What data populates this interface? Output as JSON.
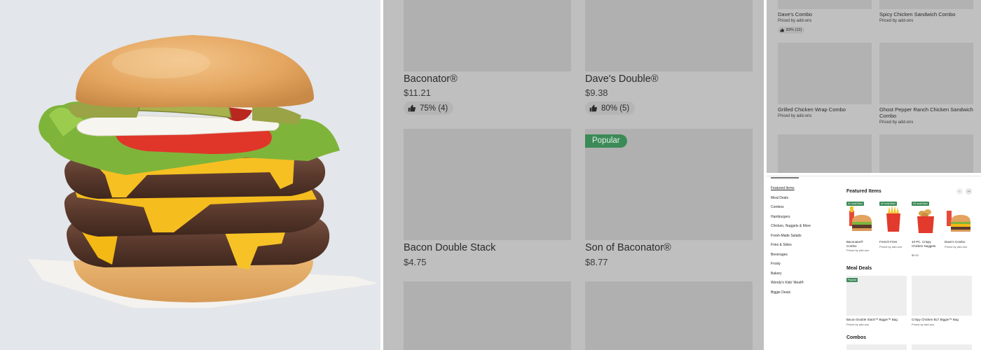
{
  "hero": {
    "image": "burger-photo",
    "background": "#e3e6ea"
  },
  "menu_grid": {
    "items": [
      {
        "name": "Baconator®",
        "price": "$11.21",
        "rating": "75% (4)"
      },
      {
        "name": "Dave's Double®",
        "price": "$9.38",
        "rating": "80% (5)"
      },
      {
        "name": "Bacon Double Stack",
        "price": "$4.75"
      },
      {
        "name": "Son of Baconator®",
        "price": "$8.77",
        "badge": "Popular"
      }
    ]
  },
  "combo_grid": {
    "items": [
      {
        "name": "Dave's Combo",
        "subtitle": "Priced by add-ons",
        "rating": "83% (12)"
      },
      {
        "name": "Spicy Chicken Sandwich Combo",
        "subtitle": "Priced by add-ons"
      },
      {
        "name": "Grilled Chicken Wrap Combo",
        "subtitle": "Priced by add-ons"
      },
      {
        "name": "Ghost Pepper Ranch Chicken Sandwich Combo",
        "subtitle": "Priced by add-ons"
      }
    ]
  },
  "store_page": {
    "sidebar": [
      "Featured Items",
      "Meal Deals",
      "Combos",
      "Hamburgers",
      "Chicken, Nuggets & More",
      "Fresh-Made Salads",
      "Fries & Sides",
      "Beverages",
      "Frosty",
      "Bakery",
      "Wendy's Kids' Meal®",
      "Biggie Deals"
    ],
    "featured": {
      "title": "Featured Items",
      "prev_arrow": "←",
      "next_arrow": "→",
      "items": [
        {
          "badge": "#1 most liked",
          "name": "Baconator® Combo",
          "subtitle": "Priced by add-ons"
        },
        {
          "badge": "#2 most liked",
          "name": "French Fries",
          "subtitle": "Priced by add-ons"
        },
        {
          "badge": "#3 most liked",
          "name": "10 PC. Crispy Chicken Nuggets",
          "subtitle": "$6.62"
        },
        {
          "name": "Dave's Combo",
          "subtitle": "Priced by add-ons"
        }
      ]
    },
    "meal_deals": {
      "title": "Meal Deals",
      "items": [
        {
          "badge": "Popular",
          "name": "Bacon Double Stack™ Biggie™ Bag",
          "subtitle": "Priced by add-ons"
        },
        {
          "name": "Crispy Chicken BLT Biggie™ Bag",
          "subtitle": "Priced by add-ons"
        }
      ]
    },
    "combos_title": "Combos"
  },
  "colors": {
    "badge_green": "#3c8a57",
    "dim_overlay": "#bfbfbf"
  }
}
